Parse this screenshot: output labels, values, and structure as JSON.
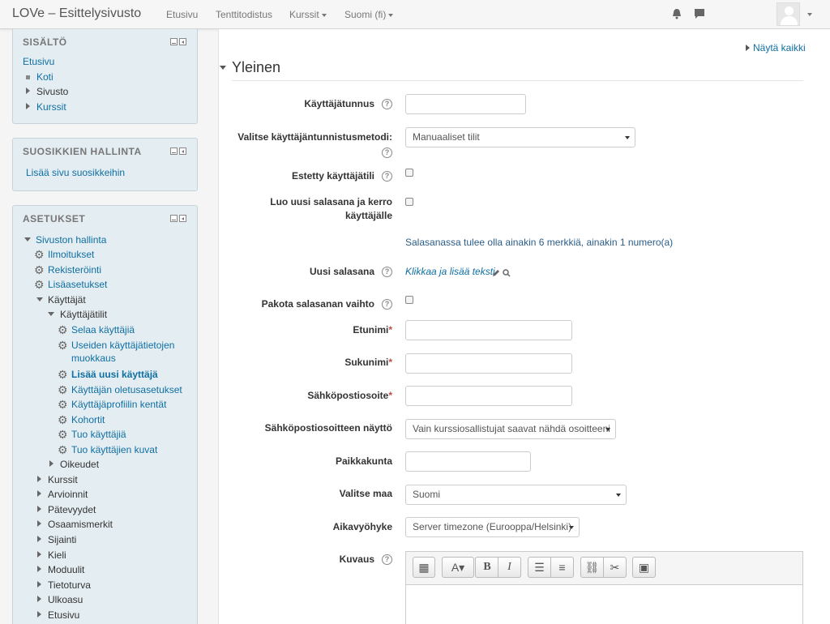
{
  "navbar": {
    "brand": "LOVe – Esittelysivusto",
    "links": [
      "Etusivu",
      "Tenttitodistus",
      "Kurssit",
      "Suomi (fi)"
    ]
  },
  "blocks": {
    "navigation": {
      "title": "SISÄLTÖ",
      "items": [
        "Etusivu",
        "Koti",
        "Sivusto",
        "Kurssit"
      ]
    },
    "favourites": {
      "title": "SUOSIKKIEN HALLINTA",
      "link": "Lisää sivu suosikkeihin"
    },
    "settings": {
      "title": "ASETUKSET",
      "items": [
        "Sivuston hallinta",
        "Ilmoitukset",
        "Rekisteröinti",
        "Lisäasetukset",
        "Käyttäjät",
        "Käyttäjätilit",
        "Selaa käyttäjiä",
        "Useiden käyttäjätietojen",
        "muokkaus",
        "Lisää uusi käyttäjä",
        "Käyttäjän oletusasetukset",
        "Käyttäjäprofiilin kentät",
        "Kohortit",
        "Tuo käyttäjiä",
        "Tuo käyttäjien kuvat",
        "Oikeudet",
        "Kurssit",
        "Arvioinnit",
        "Pätevyydet",
        "Osaamismerkit",
        "Sijainti",
        "Kieli",
        "Moduulit",
        "Tietoturva",
        "Ulkoasu",
        "Etusivu"
      ]
    }
  },
  "main": {
    "show_all": "Näytä kaikki",
    "section": "Yleinen",
    "labels": {
      "username": "Käyttäjätunnus",
      "auth_1": "Valitse käyttäjäntunnistusmetodi:",
      "suspended": "Estetty käyttäjätili",
      "newpass_1": "Luo uusi salasana ja kerro",
      "newpass_2": "käyttäjälle",
      "password": "Uusi salasana",
      "force": "Pakota salasanan vaihto",
      "firstname": "Etunimi",
      "lastname": "Sukunimi",
      "email": "Sähköpostiosoite",
      "emaildisplay": "Sähköpostiosoitteen näyttö",
      "city": "Paikkakunta",
      "country": "Valitse maa",
      "timezone": "Aikavyöhyke",
      "description": "Kuvaus"
    },
    "required_mark": "*",
    "password_note": "Salasanassa tulee olla ainakin 6 merkkiä, ainakin 1 numero(a)",
    "password_link": "Klikkaa ja lisää teksti",
    "values": {
      "auth": "Manuaaliset tilit",
      "emaildisplay": "Vain kurssiosallistujat saavat nähdä osoitteeni",
      "country": "Suomi",
      "timezone": "Server timezone (Eurooppa/Helsinki)"
    }
  }
}
